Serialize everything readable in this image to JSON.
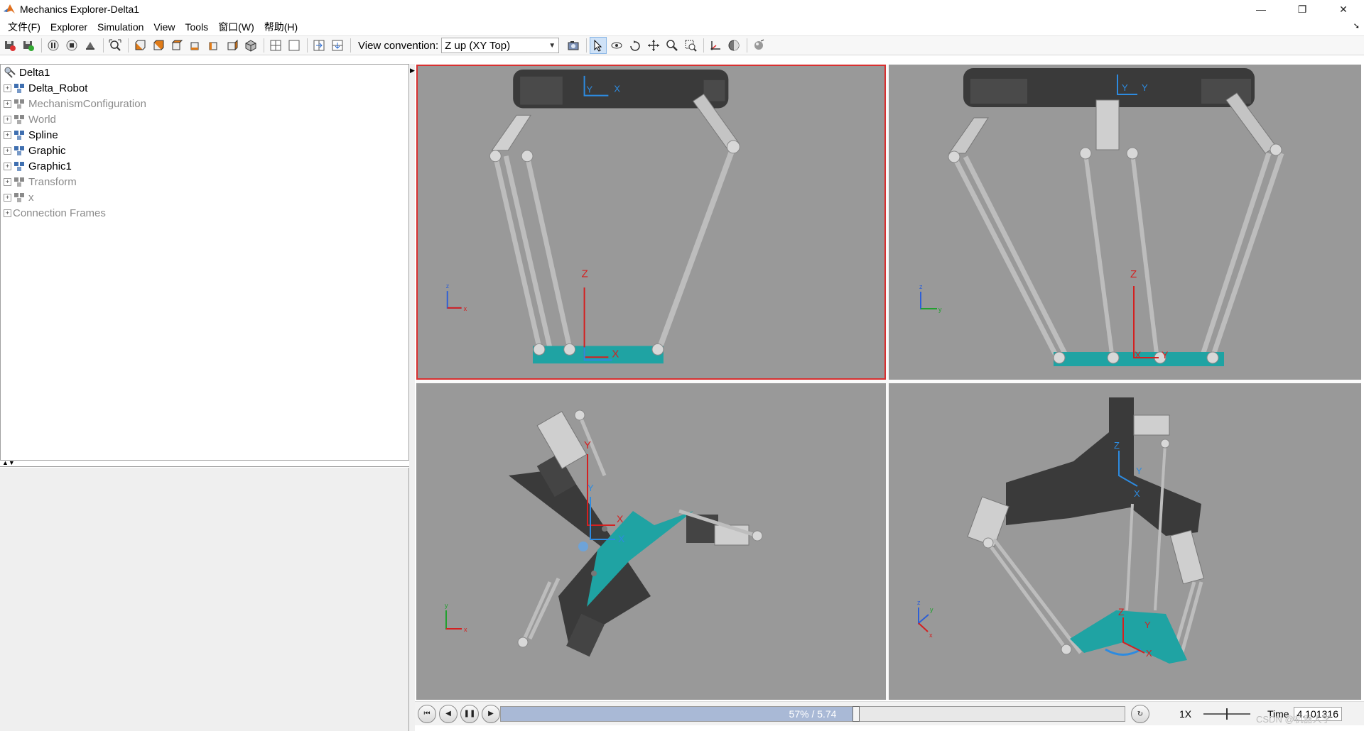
{
  "window": {
    "title": "Mechanics Explorer-Delta1",
    "minimize_glyph": "—",
    "restore_glyph": "❐",
    "close_glyph": "✕"
  },
  "menu": {
    "items": [
      {
        "label": "文件(F)"
      },
      {
        "label": "Explorer"
      },
      {
        "label": "Simulation"
      },
      {
        "label": "View"
      },
      {
        "label": "Tools"
      },
      {
        "label": "窗口(W)"
      },
      {
        "label": "帮助(H)"
      }
    ]
  },
  "toolbar": {
    "view_convention_label": "View convention:",
    "view_convention_value": "Z up (XY Top)"
  },
  "tree": {
    "root": "Delta1",
    "items": [
      {
        "label": "Delta_Robot",
        "muted": false,
        "icon": "robot-icon"
      },
      {
        "label": "MechanismConfiguration",
        "muted": true,
        "icon": "mechanism-icon"
      },
      {
        "label": "World",
        "muted": true,
        "icon": "world-frame-icon"
      },
      {
        "label": "Spline",
        "muted": false,
        "icon": "spline-icon"
      },
      {
        "label": "Graphic",
        "muted": false,
        "icon": "graphic-icon"
      },
      {
        "label": "Graphic1",
        "muted": false,
        "icon": "graphic-icon"
      },
      {
        "label": "Transform",
        "muted": true,
        "icon": "transform-icon"
      },
      {
        "label": "x",
        "muted": true,
        "icon": "joint-icon"
      },
      {
        "label": "Connection Frames",
        "muted": true,
        "icon": ""
      }
    ]
  },
  "viewports": {
    "axis_labels": {
      "x": "X",
      "y": "Y",
      "z": "Z"
    },
    "triad_labels": {
      "x": "x",
      "y": "y",
      "z": "z"
    }
  },
  "playback": {
    "progress_text": "57% / 5.74",
    "progress_fraction": 0.57,
    "speed": "1X",
    "time_label": "Time",
    "time_value": "4.101316"
  },
  "watermark": "CSDN @机器人学",
  "colors": {
    "viewport_bg": "#999999",
    "selected_viewport_border": "#d83030",
    "platform_teal": "#1fa3a3",
    "frame_blue": "#2d8be0",
    "frame_red": "#d42020",
    "base_dark": "#3a3a3a"
  }
}
